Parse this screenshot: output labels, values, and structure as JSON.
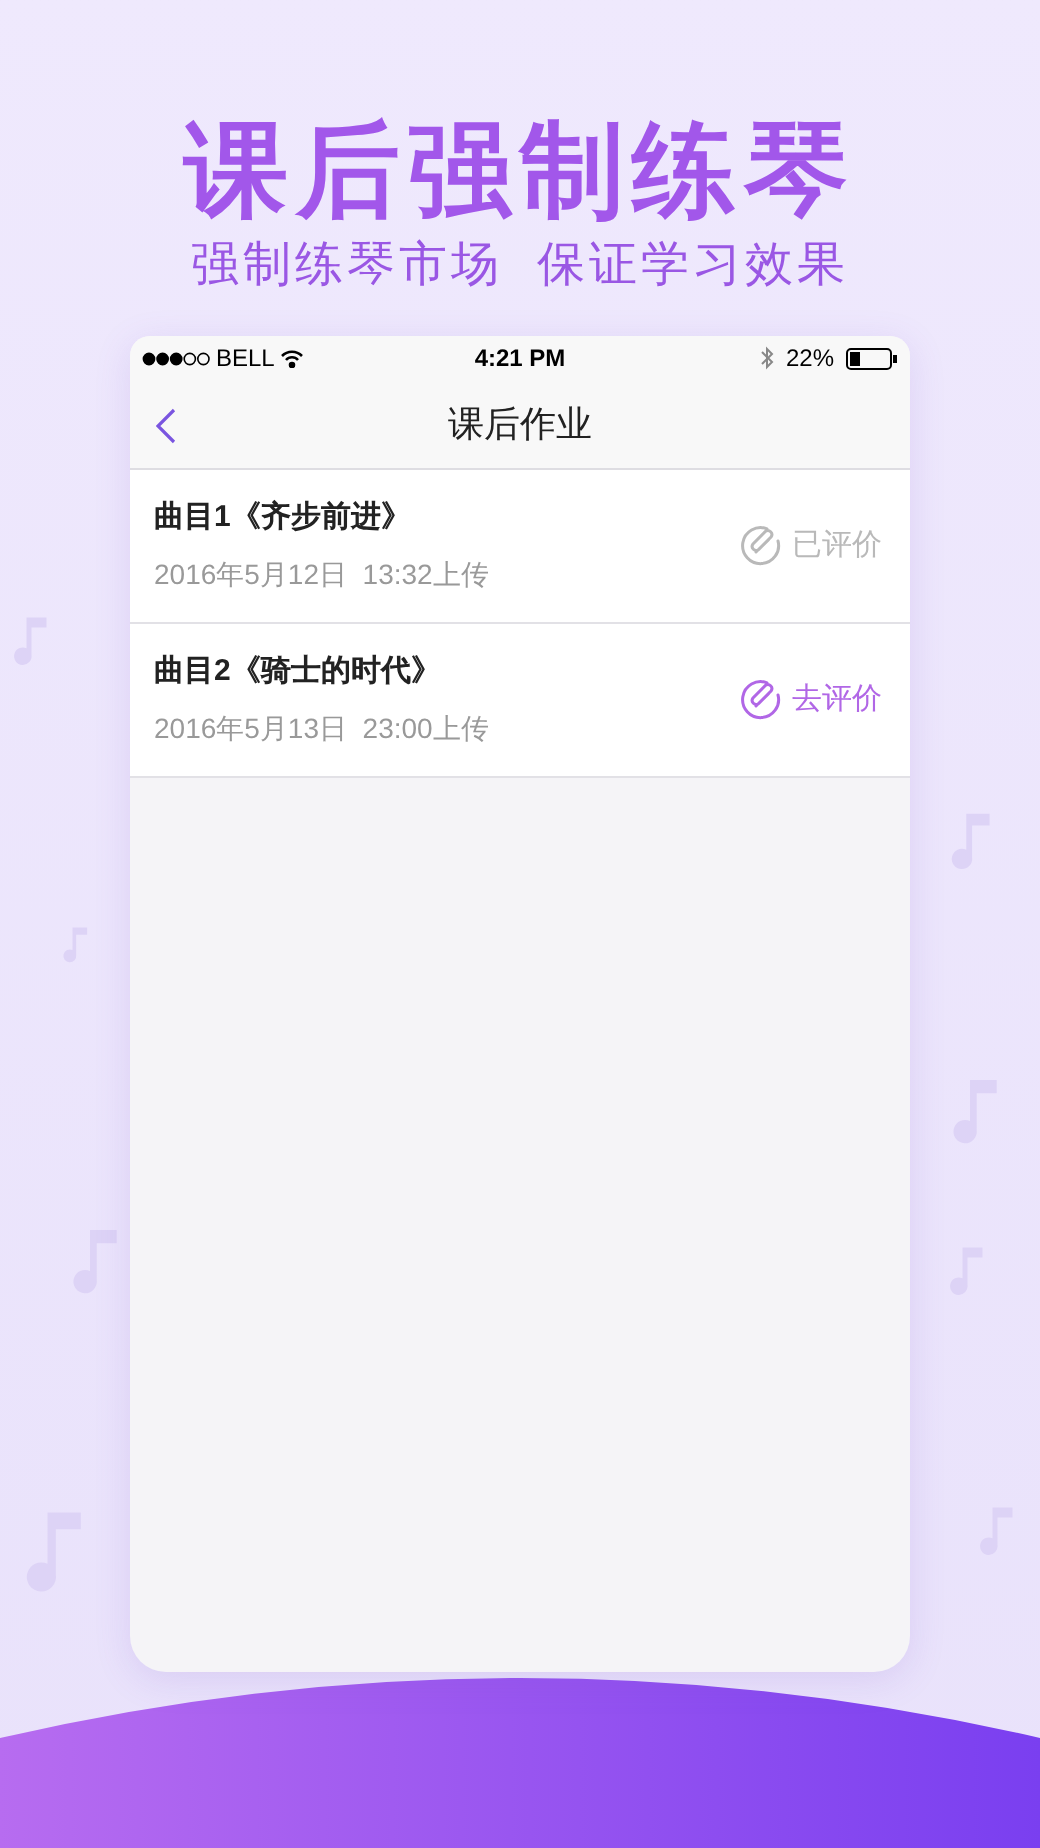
{
  "headline": "课后强制练琴",
  "subheadline": "强制练琴市场  保证学习效果",
  "status_bar": {
    "carrier": "BELL",
    "time": "4:21 PM",
    "battery": "22%"
  },
  "nav": {
    "title": "课后作业"
  },
  "rows": [
    {
      "title": "曲目1《齐步前进》",
      "subtitle": "2016年5月12日  13:32上传",
      "action": "已评价",
      "reviewed": true
    },
    {
      "title": "曲目2《骑士的时代》",
      "subtitle": "2016年5月13日  23:00上传",
      "action": "去评价",
      "reviewed": false
    }
  ]
}
